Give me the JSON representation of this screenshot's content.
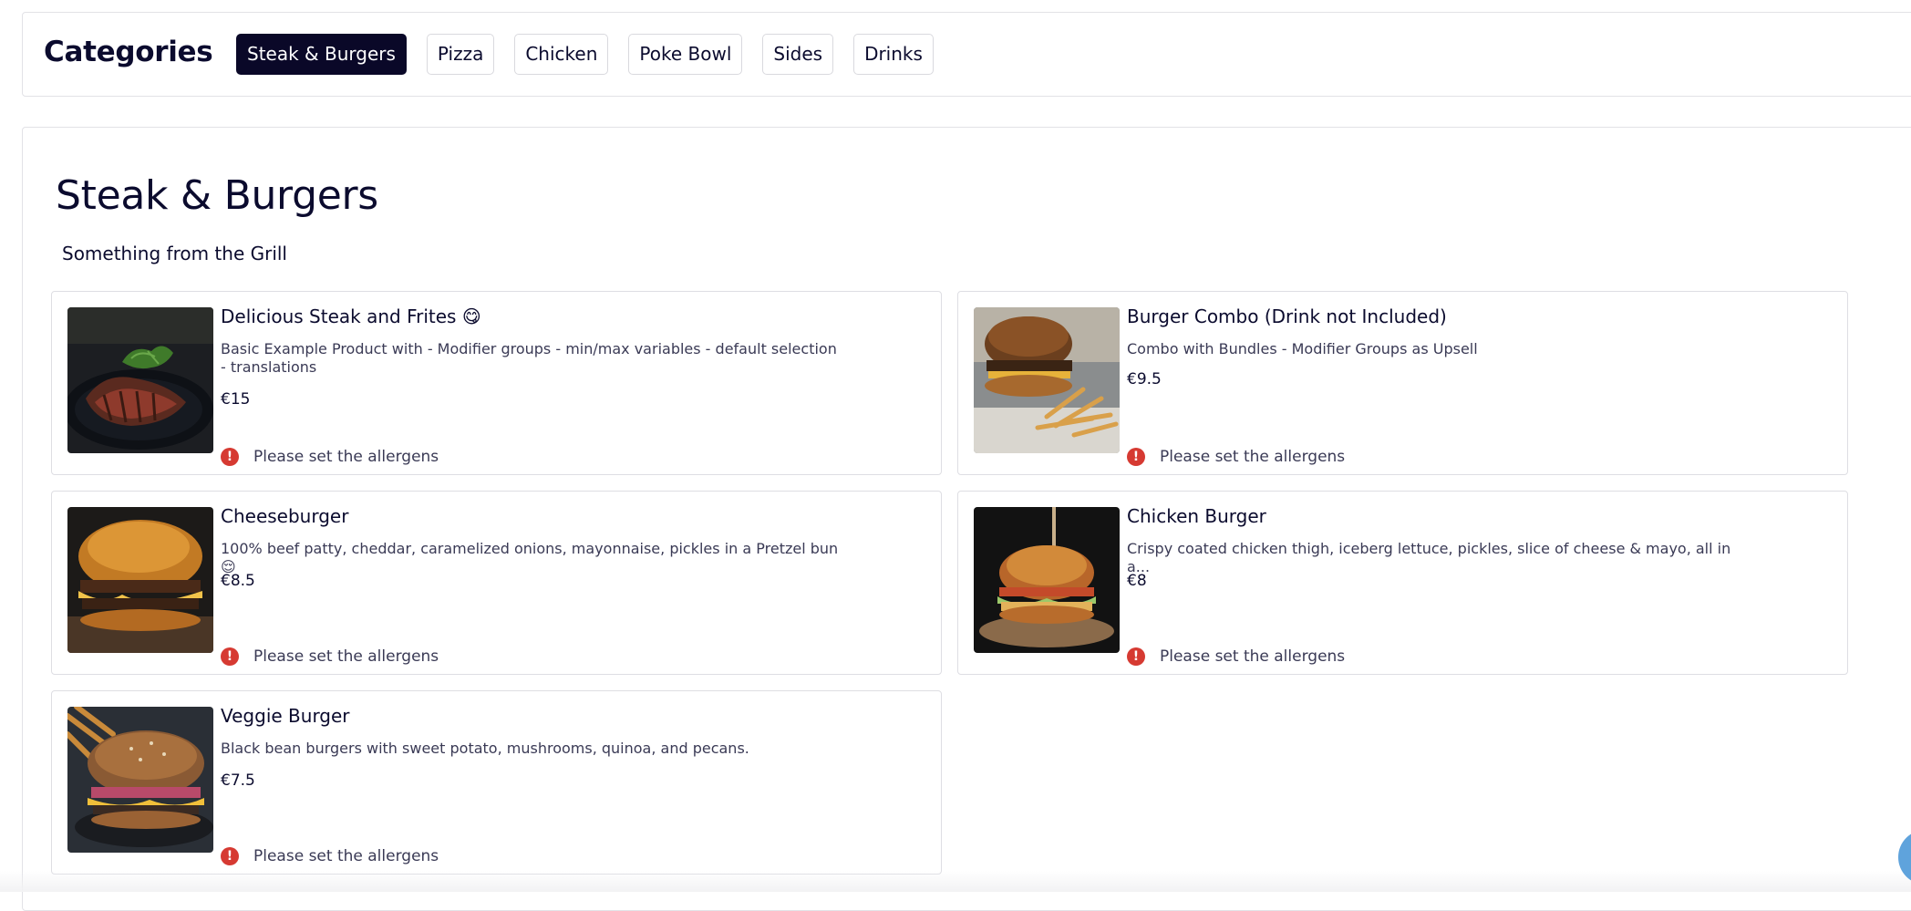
{
  "categories": {
    "title": "Categories",
    "items": [
      {
        "label": "Steak & Burgers",
        "active": true
      },
      {
        "label": "Pizza",
        "active": false
      },
      {
        "label": "Chicken",
        "active": false
      },
      {
        "label": "Poke Bowl",
        "active": false
      },
      {
        "label": "Sides",
        "active": false
      },
      {
        "label": "Drinks",
        "active": false
      }
    ]
  },
  "section": {
    "title": "Steak & Burgers",
    "subtitle": "Something from the Grill"
  },
  "products": [
    {
      "name": "Delicious Steak and Frites 😋",
      "description": "Basic Example Product with - Modifier groups - min/max variables - default selection - translations",
      "price": "€15",
      "allergen_notice": "Please set the allergens"
    },
    {
      "name": "Burger Combo (Drink not Included)",
      "description": "Combo with Bundles - Modifier Groups as Upsell",
      "price": "€9.5",
      "allergen_notice": "Please set the allergens"
    },
    {
      "name": "Cheeseburger",
      "description": "100% beef patty, cheddar, caramelized onions, mayonnaise, pickles in a Pretzel bun😌",
      "price": "€8.5",
      "allergen_notice": "Please set the allergens"
    },
    {
      "name": "Chicken Burger",
      "description": "Crispy coated chicken thigh, iceberg lettuce, pickles, slice of cheese & mayo, all in a...",
      "price": "€8",
      "allergen_notice": "Please set the allergens"
    },
    {
      "name": "Veggie Burger",
      "description": "Black bean burgers with sweet potato, mushrooms, quinoa, and pecans.",
      "price": "€7.5",
      "allergen_notice": "Please set the allergens"
    }
  ],
  "icons": {
    "allergen_alert": "exclamation-circle-icon",
    "chat": "chat-launcher-icon"
  },
  "colors": {
    "active_category_bg": "#0a0828",
    "alert_red": "#d63a32",
    "text_dark": "#0b0b2e"
  }
}
